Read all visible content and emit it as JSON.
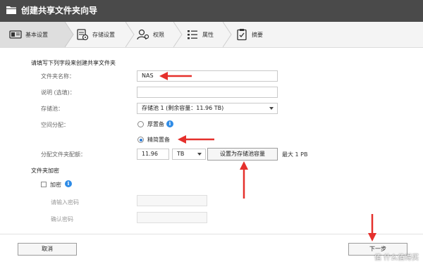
{
  "window": {
    "title": "创建共享文件夹向导",
    "folder_icon": "folder-icon"
  },
  "steps": [
    {
      "label": "基本设置",
      "icon": "general-settings-icon",
      "active": true
    },
    {
      "label": "存储设置",
      "icon": "storage-settings-icon",
      "active": false
    },
    {
      "label": "权限",
      "icon": "user-permission-icon",
      "active": false
    },
    {
      "label": "属性",
      "icon": "properties-list-icon",
      "active": false
    },
    {
      "label": "摘要",
      "icon": "summary-clipboard-icon",
      "active": false
    }
  ],
  "form": {
    "heading": "请填写下列字段来创建共享文件夹",
    "folder_name": {
      "label": "文件夹名称：",
      "value": "NAS"
    },
    "description": {
      "label": "说明 (选填)：",
      "value": ""
    },
    "storage_pool": {
      "label": "存储池：",
      "value": "存储池 1 (剩余容量：11.96 TB)"
    },
    "space_allocation": {
      "label": "空间分配：",
      "options": [
        {
          "label": "厚置备",
          "selected": false
        },
        {
          "label": "精简置备",
          "selected": true
        }
      ]
    },
    "allocated_size": {
      "label": "分配文件夹配额：",
      "value": "11.96",
      "unit": "TB",
      "set_button": "设置为存储池容量",
      "max_note": "最大 1 PB"
    },
    "encryption": {
      "section_title": "文件夹加密",
      "checkbox_label": "加密",
      "checked": false,
      "password_label": "请输入密码",
      "confirm_label": "确认密码"
    }
  },
  "footer": {
    "cancel": "取消",
    "next": "下一步"
  },
  "watermark": "值 什么值得买",
  "colors": {
    "titlebar": "#4a4a4a",
    "accent_blue": "#2e7cd6",
    "annotation_red": "#e5302c"
  }
}
